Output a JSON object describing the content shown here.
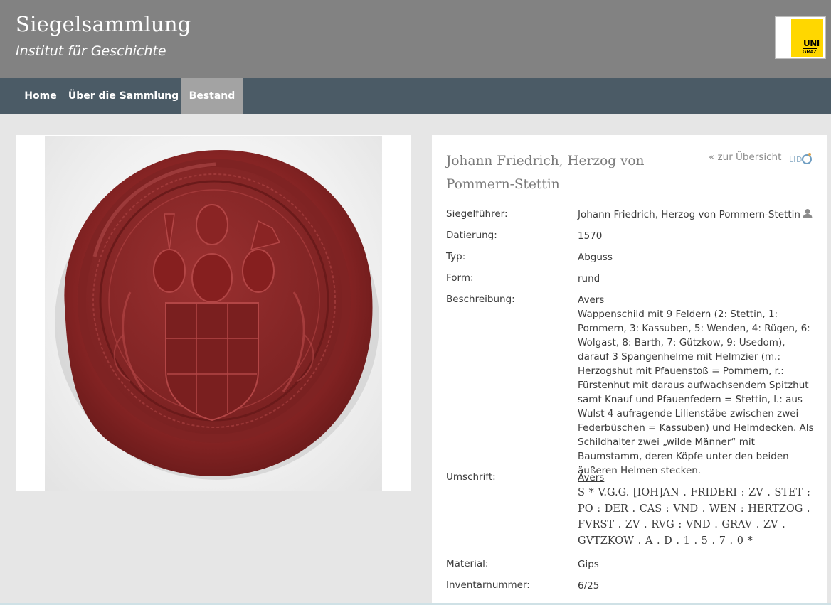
{
  "header": {
    "title": "Siegelsammlung",
    "subtitle": "Institut für Geschichte",
    "logo_text_top": "UNI",
    "logo_text_bottom": "GRAZ"
  },
  "nav": {
    "items": [
      {
        "label": "Home",
        "active": false
      },
      {
        "label": "Über die Sammlung",
        "active": false
      },
      {
        "label": "Bestand",
        "active": true
      }
    ]
  },
  "record": {
    "title": "Johann Friedrich, Herzog von Pommern-Stettin",
    "back_link": "« zur Übersicht",
    "fields": {
      "siegelfuehrer": {
        "label": "Siegelführer:",
        "value": "Johann Friedrich, Herzog von Pommern-Stettin"
      },
      "datierung": {
        "label": "Datierung:",
        "value": "1570"
      },
      "typ": {
        "label": "Typ:",
        "value": "Abguss"
      },
      "form": {
        "label": "Form:",
        "value": "rund"
      },
      "beschreibung": {
        "label": "Beschreibung:",
        "side": "Avers",
        "value": "Wappenschild mit 9 Feldern (2: Stettin, 1: Pommern, 3: Kassuben, 5: Wenden, 4: Rügen, 6: Wolgast, 8: Barth, 7: Gützkow, 9: Usedom), darauf 3 Spangenhelme mit Helmzier (m.: Herzogshut mit Pfauenstoß = Pommern, r.: Fürstenhut mit daraus aufwachsendem Spitzhut samt Knauf und Pfauenfedern = Stettin, l.: aus Wulst 4 aufragende Lilienstäbe zwischen zwei Federbüschen = Kassuben) und Helmdecken. Als Schildhalter zwei „wilde Männer“ mit Baumstamm, deren Köpfe unter den beiden äußeren Helmen stecken."
      },
      "umschrift": {
        "label": "Umschrift:",
        "side": "Avers",
        "value": "S * V.G.G. [IOH]AN . FRIDERI : ZV . STET : PO : DER . CAS : VND . WEN : HERTZOG . FVRST . ZV . RVG : VND . GRAV . ZV . GVTZKOW . A . D . 1 . 5 . 7 . 0 *"
      },
      "material": {
        "label": "Material:",
        "value": "Gips"
      },
      "inventarnummer": {
        "label": "Inventarnummer:",
        "value": "6/25"
      }
    }
  },
  "icons": {
    "person": "person-icon",
    "lido": "lido-logo-icon"
  },
  "colors": {
    "header_bg": "#828282",
    "nav_bg": "#4b5b66",
    "nav_active_bg": "#a3a3a3",
    "seal_red": "#8e2424",
    "logo_yellow": "#ffd700"
  }
}
